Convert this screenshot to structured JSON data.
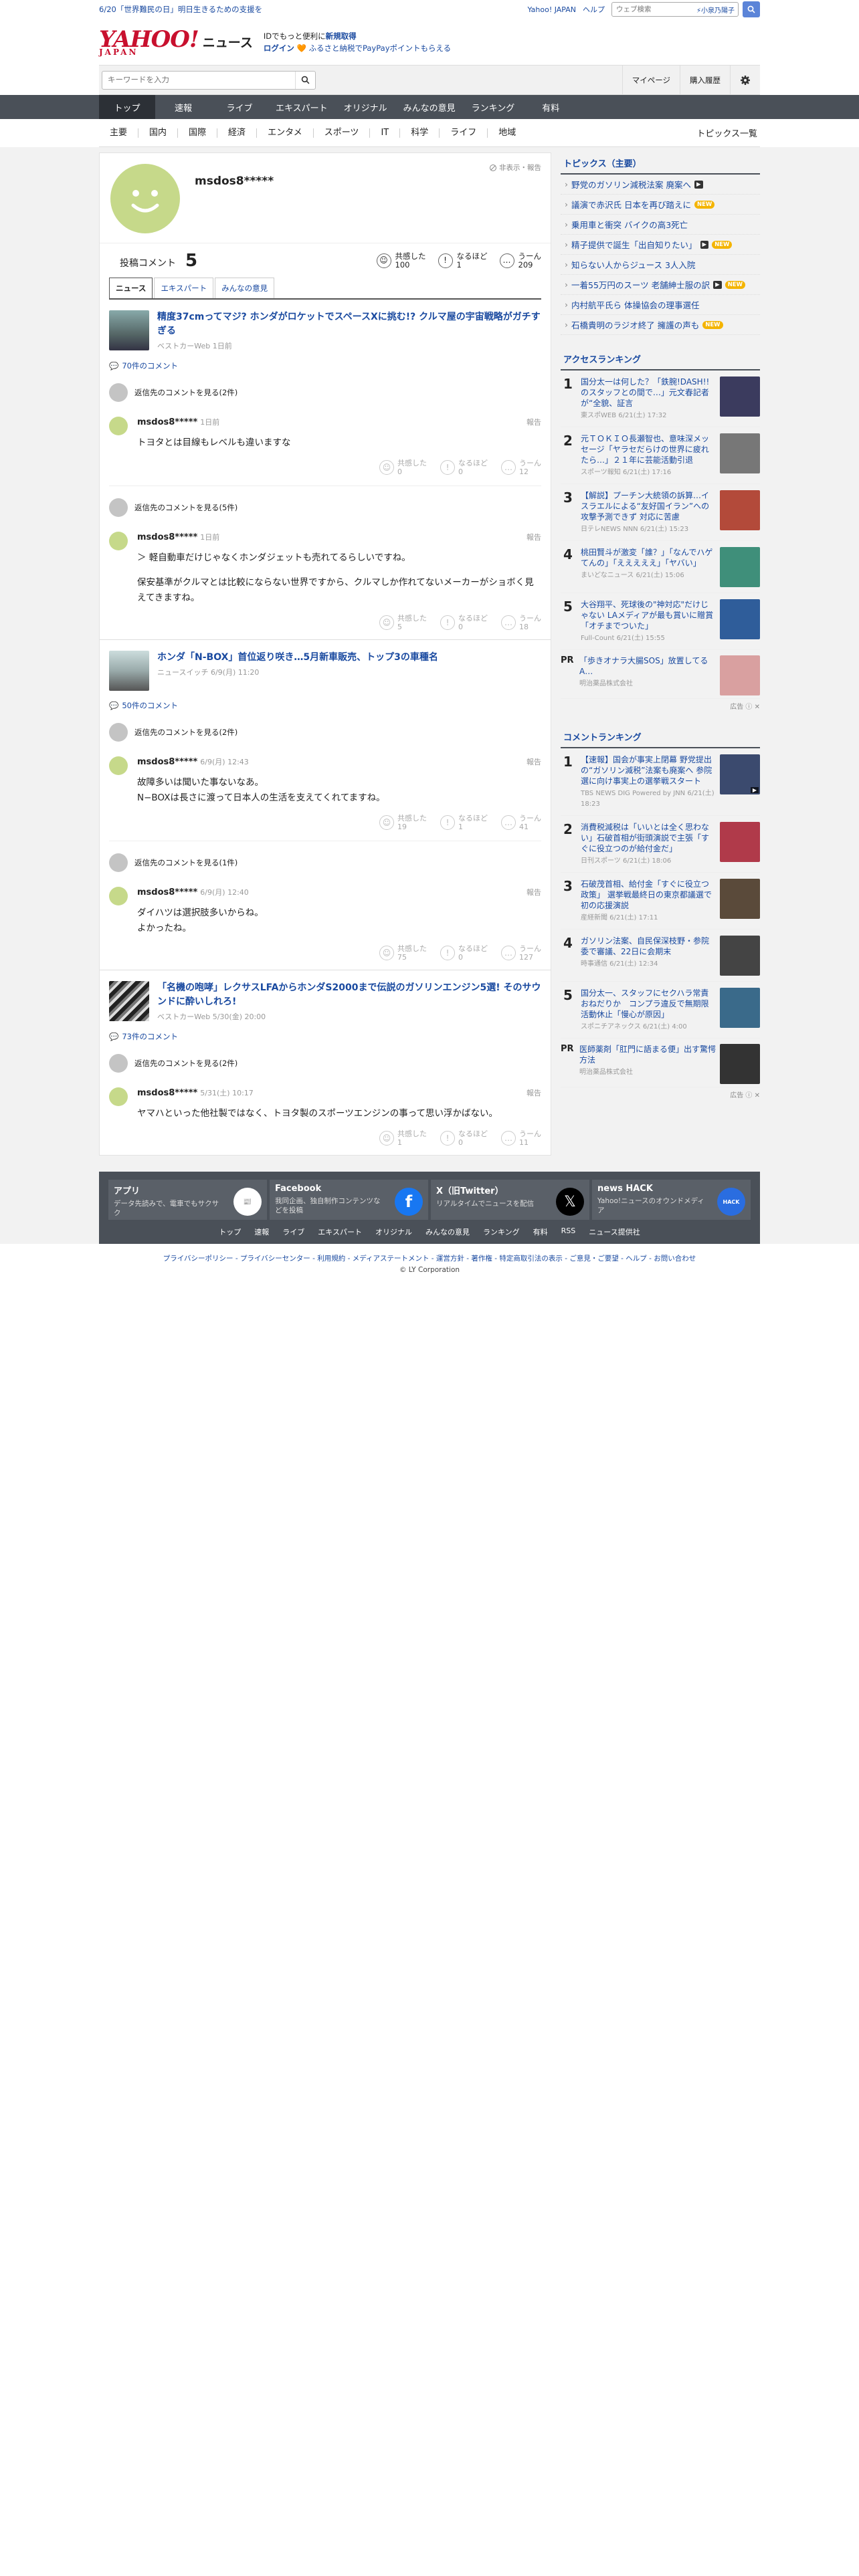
{
  "topbar": {
    "notice": "6/20「世界難民の日」明日生きるための支援を",
    "links": [
      "Yahoo! JAPAN",
      "ヘルプ"
    ],
    "web_search_placeholder": "ウェブ検索",
    "search_chip": "小泉乃陽子"
  },
  "header": {
    "logo_text": "YAHOO!",
    "logo_sub": "JAPAN",
    "service": "ニュース",
    "promo_line1_a": "IDでもっと便利に",
    "promo_line1_b": "新規取得",
    "promo_login": "ログイン",
    "promo_line2": "ふるさと納税でPayPayポイントもらえる"
  },
  "searchrow": {
    "placeholder": "キーワードを入力",
    "mypage": "マイページ",
    "history": "購入履歴"
  },
  "nav": {
    "tabs": [
      "トップ",
      "速報",
      "ライブ",
      "エキスパート",
      "オリジナル",
      "みんなの意見",
      "ランキング",
      "有料"
    ],
    "subnav": [
      "主要",
      "国内",
      "国際",
      "経済",
      "エンタメ",
      "スポーツ",
      "IT",
      "科学",
      "ライフ",
      "地域"
    ],
    "topics_list": "トピックス一覧"
  },
  "profile": {
    "name": "msdos8*****",
    "hide_report": "非表示・報告",
    "post_label": "投稿コメント",
    "post_count": "5",
    "reactions": [
      {
        "label": "共感した",
        "value": "100"
      },
      {
        "label": "なるほど",
        "value": "1"
      },
      {
        "label": "うーん",
        "value": "209"
      }
    ],
    "tabs": [
      "ニュース",
      "エキスパート",
      "みんなの意見"
    ]
  },
  "articles": [
    {
      "title": "精度37cmってマジ? ホンダがロケットでスペースXに挑む!? クルマ屋の宇宙戦略がガチすぎる",
      "source": "ベストカーWeb 1日前",
      "comment_link": "70件のコメント",
      "threads": [
        {
          "prev": "返信先のコメントを見る(2件)",
          "user": "msdos8*****",
          "time": "1日前",
          "report": "報告",
          "text": "トヨタとは目線もレベルも違いますな",
          "acts": [
            {
              "label": "共感した",
              "v": "0"
            },
            {
              "label": "なるほど",
              "v": "0"
            },
            {
              "label": "うーん",
              "v": "12"
            }
          ]
        },
        {
          "prev": "返信先のコメントを見る(5件)",
          "user": "msdos8*****",
          "time": "1日前",
          "report": "報告",
          "text": "＞ 軽自動車だけじゃなくホンダジェットも売れてるらしいです。\n保安基準がクルマとは比較にならない世界ですから、クルマしか作れてないメーカーがショボく見えてきますね。",
          "text_pre": "＞ 軽自動車だけじゃなくホンダジェットも売れてるらしいですね。",
          "acts": [
            {
              "label": "共感した",
              "v": "5"
            },
            {
              "label": "なるほど",
              "v": "0"
            },
            {
              "label": "うーん",
              "v": "18"
            }
          ]
        }
      ]
    },
    {
      "title": "ホンダ「N-BOX」首位返り咲き…5月新車販売、トップ3の車種名",
      "source": "ニュースイッチ 6/9(月) 11:20",
      "comment_link": "50件のコメント",
      "threads": [
        {
          "prev": "返信先のコメントを見る(2件)",
          "user": "msdos8*****",
          "time": "6/9(月) 12:43",
          "report": "報告",
          "text": "故障多いは聞いた事ないなあ。\nN−BOXは長さに渡って日本人の生活を支えてくれてますね。",
          "acts": [
            {
              "label": "共感した",
              "v": "19"
            },
            {
              "label": "なるほど",
              "v": "1"
            },
            {
              "label": "うーん",
              "v": "41"
            }
          ]
        },
        {
          "prev": "返信先のコメントを見る(1件)",
          "user": "msdos8*****",
          "time": "6/9(月) 12:40",
          "report": "報告",
          "text": "ダイハツは選択肢多いからね。\nよかったね。",
          "acts": [
            {
              "label": "共感した",
              "v": "75"
            },
            {
              "label": "なるほど",
              "v": "0"
            },
            {
              "label": "うーん",
              "v": "127"
            }
          ]
        }
      ]
    },
    {
      "title": "「名機の咆哮」レクサスLFAからホンダS2000まで伝説のガソリンエンジン5選! そのサウンドに酔いしれろ!",
      "source": "ベストカーWeb 5/30(金) 20:00",
      "comment_link": "73件のコメント",
      "threads": [
        {
          "prev": "返信先のコメントを見る(2件)",
          "user": "msdos8*****",
          "time": "5/31(土) 10:17",
          "report": "報告",
          "text": "ヤマハといった他社製ではなく、トヨタ製のスポーツエンジンの事って思い浮かばない。",
          "acts": [
            {
              "label": "共感した",
              "v": "1"
            },
            {
              "label": "なるほど",
              "v": "0"
            },
            {
              "label": "うーん",
              "v": "11"
            }
          ]
        }
      ]
    }
  ],
  "sidebar": {
    "topics_title": "トピックス（主要）",
    "topics": [
      {
        "text": "野党のガソリン減税法案 廃案へ",
        "badge": "▶"
      },
      {
        "text": "議演で赤沢氏 日本を再び踏えに",
        "badge": "NEW"
      },
      {
        "text": "乗用車と衝突 バイクの高3死亡",
        "badge": ""
      },
      {
        "text": "精子提供で誕生「出自知りたい」",
        "badge": "▶NEW"
      },
      {
        "text": "知らない人からジュース 3人入院",
        "badge": ""
      },
      {
        "text": "一着55万円のスーツ 老舗紳士服の訳",
        "badge": "▶NEW"
      },
      {
        "text": "内村航平氏ら 体操協会の理事選任",
        "badge": ""
      },
      {
        "text": "石橋貴明のラジオ終了 擁護の声も",
        "badge": "NEW"
      }
    ],
    "access_title": "アクセスランキング",
    "access": [
      {
        "n": "1",
        "text": "国分太一は何した？「鉄腕!DASH!!のスタッフとの間で…」元文春記者が“全貌、証言",
        "src": "東スポWEB 6/21(土) 17:32",
        "color": "#3b3b5e"
      },
      {
        "n": "2",
        "text": "元ＴＯＫＩＯ長瀬智也、意味深メッセージ「ヤラセだらけの世界に疲れたら…」２１年に芸能活動引退",
        "src": "スポーツ報知 6/21(土) 17:16",
        "color": "#777"
      },
      {
        "n": "3",
        "text": "【解説】プーチン大統領の訴算…イスラエルによる“友好国イラン”への攻撃予測できず 対応に苦慮",
        "src": "日テレNEWS NNN 6/21(土) 15:23",
        "color": "#b34a3a"
      },
      {
        "n": "4",
        "text": "桃田賢斗が激変「誰？」「なんでハゲてんの」「えええええ」「ヤバい」",
        "src": "まいどなニュース 6/21(土) 15:06",
        "color": "#3f8f7a"
      },
      {
        "n": "5",
        "text": "大谷翔平、死球後の\"神対応\"だけじゃない LAメディアが最も賞いに贈賞「オチまでついた」",
        "src": "Full-Count 6/21(土) 15:55",
        "color": "#2f5d9a"
      }
    ],
    "pr1_label": "PR",
    "pr1_text": "「歩きオナラ大腸SOS」放置してるA…",
    "pr1_src": "明治薬品株式会社",
    "ad_label": "広告",
    "comment_title": "コメントランキング",
    "comments": [
      {
        "n": "1",
        "text": "【速報】国会が事実上閉幕 野党提出の“ガソリン減税”法案も廃案へ 参院選に向け事実上の選挙戦スタート",
        "src": "TBS NEWS DIG Powered by JNN 6/21(土) 18:23",
        "color": "#3b4a6e"
      },
      {
        "n": "2",
        "text": "消費税減税は「いいとは全く思わない」石破首相が街頭演説で主張「すぐに役立つのが給付金だ」",
        "src": "日刊スポーツ 6/21(土) 18:06",
        "color": "#b03a4a"
      },
      {
        "n": "3",
        "text": "石破茂首相、給付金「すぐに役立つ政策」 選挙戦最終日の東京都議選で初の応援演説",
        "src": "産経新聞 6/21(土) 17:11",
        "color": "#5a4a3a"
      },
      {
        "n": "4",
        "text": "ガソリン法案、自民保深枝野・参院委で審議、22日に会期末",
        "src": "時事通信 6/21(土) 12:34",
        "color": "#444"
      },
      {
        "n": "5",
        "text": "国分太一、スタッフにセクハラ常責おねだりか　コンプラ違反で無期限活動休止「慢心が原因」",
        "src": "スポニチアネックス 6/21(土) 4:00",
        "color": "#3a6a8a"
      }
    ],
    "pr2_label": "PR",
    "pr2_text": "医師薬剤「肛門に語まる便」出す驚愕方法",
    "pr2_src": "明治薬品株式会社"
  },
  "footer": {
    "apps": [
      {
        "title": "アプリ",
        "desc": "データ先読みで、電車でもサクサク"
      },
      {
        "title": "Facebook",
        "desc": "我同企画、独自制作コンテンツなどを投稿"
      },
      {
        "title": "X（旧Twitter）",
        "desc": "リアルタイムでニュースを配信"
      },
      {
        "title": "news HACK",
        "desc": "Yahoo!ニュースのオウンドメディア"
      }
    ],
    "links": [
      "トップ",
      "速報",
      "ライブ",
      "エキスパート",
      "オリジナル",
      "みんなの意見",
      "ランキング",
      "有料",
      "RSS",
      "ニュース提供社"
    ],
    "legal": "プライバシーポリシー - プライバシーセンター - 利用規約 - メディアステートメント - 運営方針 - 著作権 - 特定商取引法の表示 - ご意見・ご要望 - ヘルプ - お問い合わせ",
    "copyright": "© LY Corporation"
  }
}
